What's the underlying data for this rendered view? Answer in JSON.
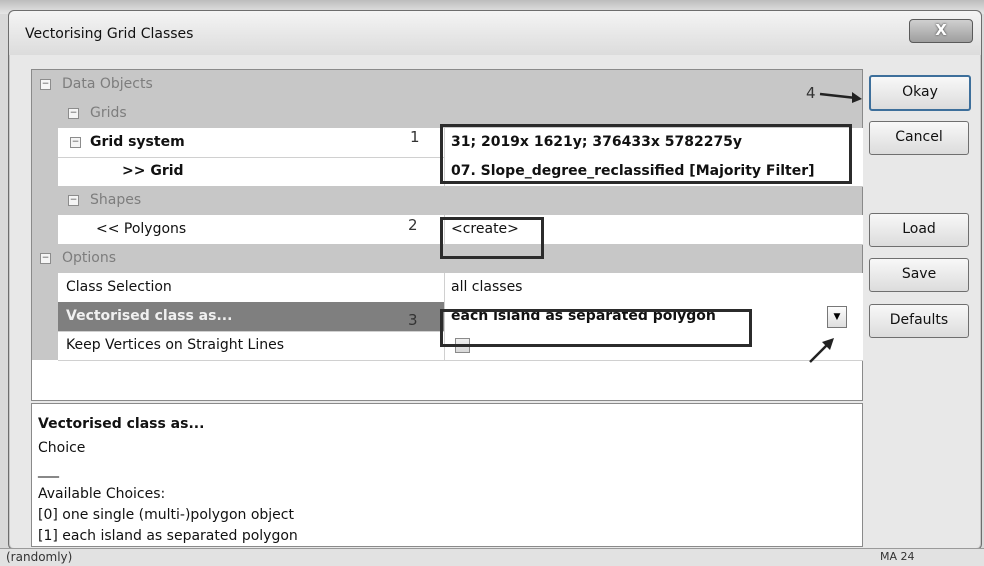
{
  "window": {
    "title": "Vectorising Grid Classes",
    "close_label": "X"
  },
  "background": {
    "bottom_left_text": "(randomly)",
    "bottom_right_text": "MA 24"
  },
  "parameters": {
    "data_objects": {
      "label": "Data Objects",
      "grids": {
        "label": "Grids",
        "grid_system": {
          "name": "Grid system",
          "value": "31; 2019x 1621y; 376433x 5782275y"
        },
        "grid": {
          "name": ">> Grid",
          "value": "07. Slope_degree_reclassified [Majority Filter]"
        }
      },
      "shapes": {
        "label": "Shapes",
        "polygons": {
          "name": "<< Polygons",
          "value": "<create>"
        }
      }
    },
    "options": {
      "label": "Options",
      "class_selection": {
        "name": "Class Selection",
        "value": "all classes"
      },
      "vectorised_class": {
        "name": "Vectorised class as...",
        "value": "each island as separated polygon"
      },
      "keep_vertices": {
        "name": "Keep Vertices on Straight Lines",
        "checked": false
      }
    }
  },
  "annotations": [
    "1",
    "2",
    "3",
    "4"
  ],
  "description": {
    "title": "Vectorised class as...",
    "type": "Choice",
    "separator": "___",
    "available_label": "Available Choices:",
    "choices": [
      "[0] one single (multi-)polygon object",
      "[1] each island as separated polygon"
    ]
  },
  "buttons": {
    "okay": "Okay",
    "cancel": "Cancel",
    "load": "Load",
    "save": "Save",
    "defaults": "Defaults"
  }
}
